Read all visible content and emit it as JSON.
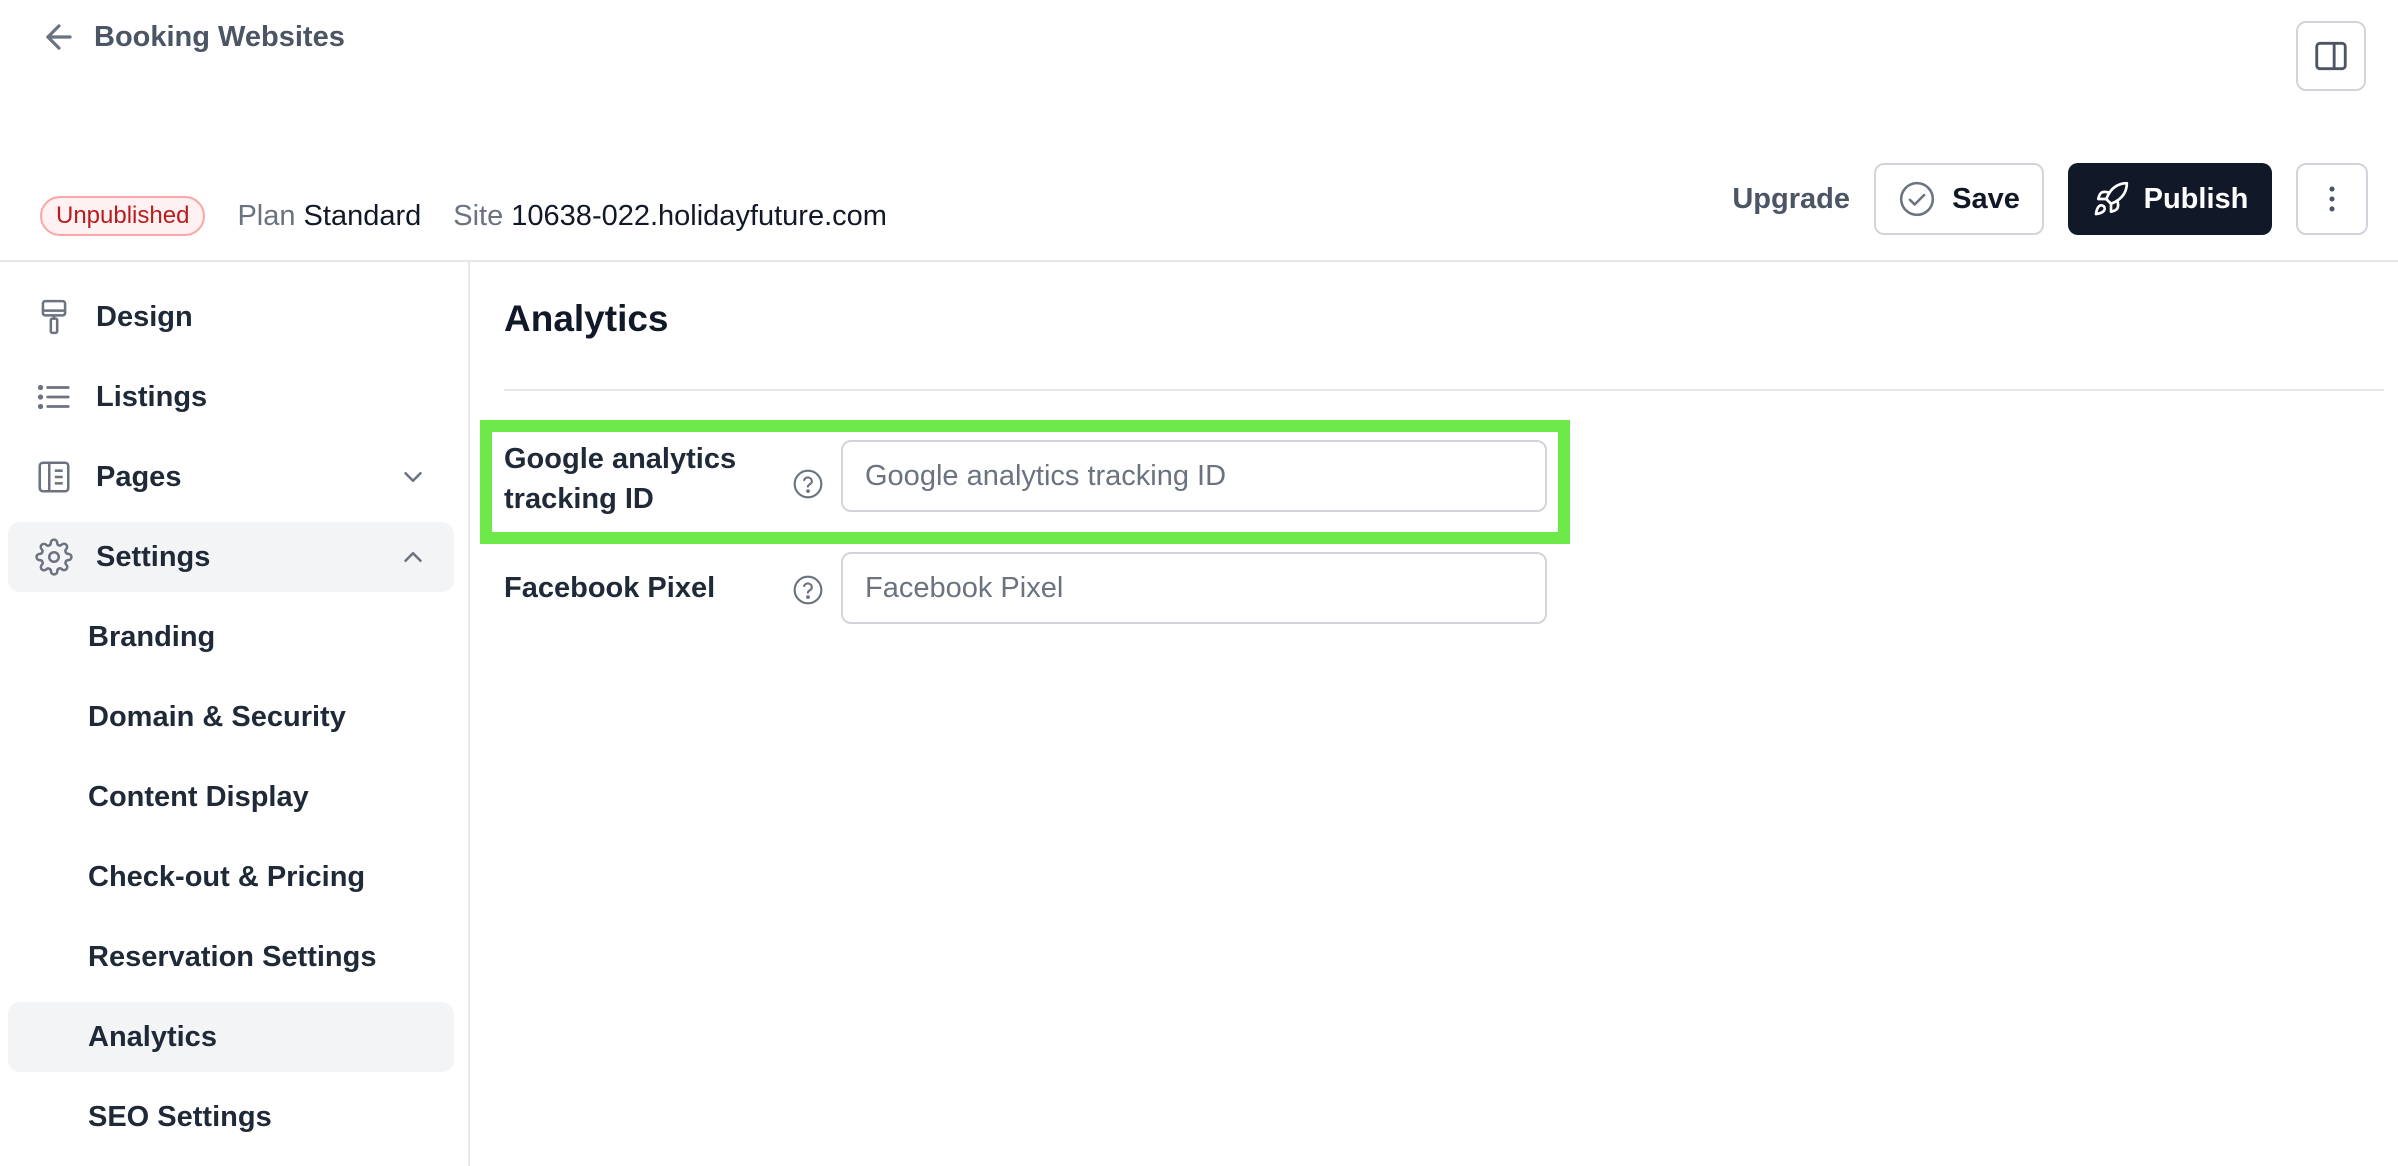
{
  "header": {
    "back_label": "Booking Websites",
    "status_badge": "Unpublished",
    "plan_label": "Plan",
    "plan_value": "Standard",
    "site_label": "Site",
    "site_value": "10638-022.holidayfuture.com",
    "upgrade_label": "Upgrade",
    "save_label": "Save",
    "publish_label": "Publish"
  },
  "sidebar": {
    "items": [
      {
        "label": "Design",
        "icon": "paint-roller-icon"
      },
      {
        "label": "Listings",
        "icon": "list-icon"
      },
      {
        "label": "Pages",
        "icon": "pages-icon"
      },
      {
        "label": "Settings",
        "icon": "gear-icon"
      }
    ],
    "settings_sub": [
      {
        "label": "Branding"
      },
      {
        "label": "Domain & Security"
      },
      {
        "label": "Content Display"
      },
      {
        "label": "Check-out & Pricing"
      },
      {
        "label": "Reservation Settings"
      },
      {
        "label": "Analytics"
      },
      {
        "label": "SEO Settings"
      }
    ]
  },
  "main": {
    "title": "Analytics",
    "fields": [
      {
        "label": "Google analytics tracking ID",
        "placeholder": "Google analytics tracking ID",
        "value": ""
      },
      {
        "label": "Facebook Pixel",
        "placeholder": "Facebook Pixel",
        "value": ""
      }
    ]
  },
  "colors": {
    "highlight": "#6ee94a",
    "publish_bg": "#111827",
    "badge_text": "#b91c1c"
  }
}
